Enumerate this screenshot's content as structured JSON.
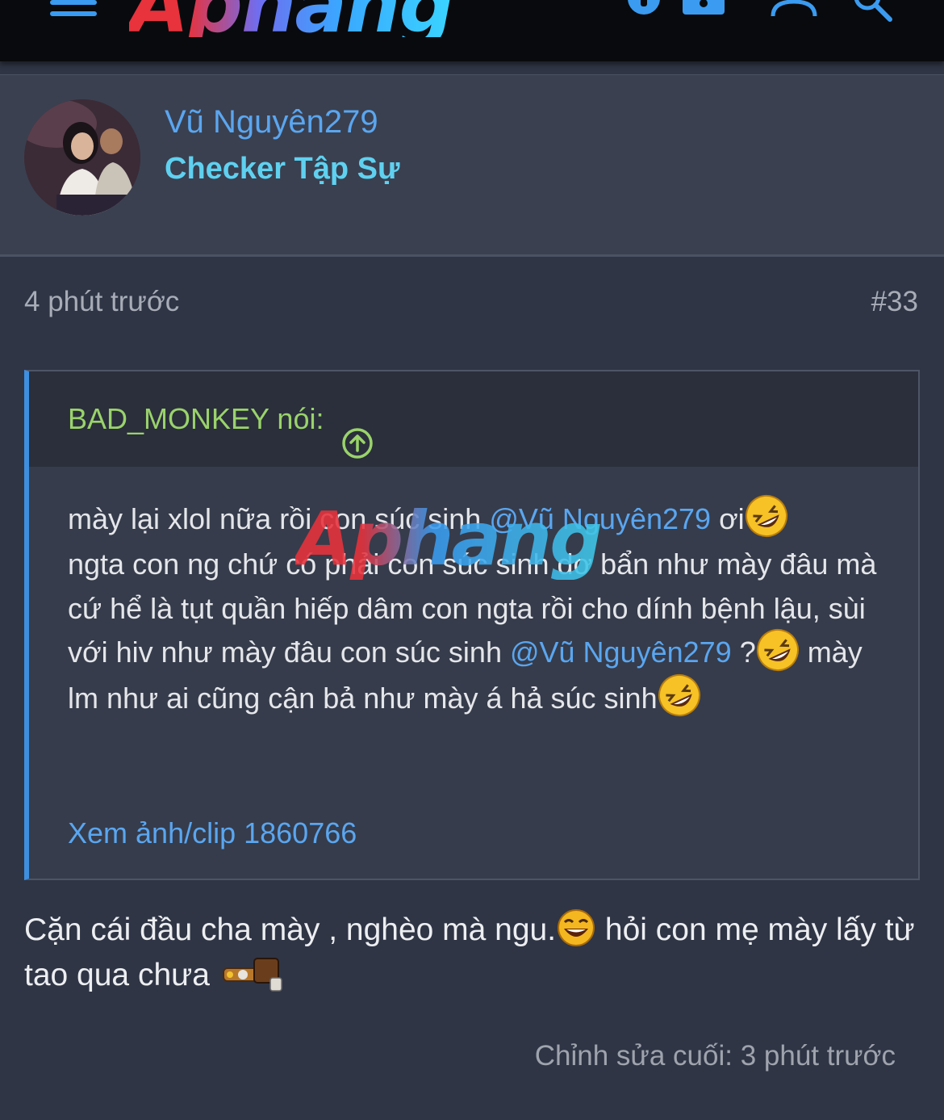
{
  "header": {
    "logo_text": "Aphang",
    "icons": [
      "menu-icon",
      "info-icon",
      "lock-icon",
      "user-icon",
      "search-icon"
    ],
    "accent": "#3a9bf0"
  },
  "post": {
    "author": {
      "name": "Vũ Nguyên279",
      "title": "Checker Tập Sự"
    },
    "time": "4 phút trước",
    "number": "#33",
    "quote": {
      "header": "BAD_MONKEY nói:",
      "segments": {
        "s1": "mày lại xlol nữa rồi con súc sinh ",
        "m1": "@Vũ Nguyên279",
        "s2": " ơi",
        "s3": "ngta con ng chứ có phải con súc sinh dơ bẩn như mày đâu mà cứ hể là tụt quần hiếp dâm con ngta rồi cho dính bệnh lậu, sùi với hiv như mày đâu con súc sinh ",
        "m2": "@Vũ Nguyên279",
        "s4": " ?",
        "s5": " mày lm như ai cũng cận bả như mày á hả súc sinh"
      },
      "link": "Xem ảnh/clip 1860766",
      "watermark": "Aphang"
    },
    "reply": {
      "part1": "Cặn cái đầu cha mày , nghèo mà ngu.",
      "part2": " hỏi con mẹ mày lấy từ tao qua chưa "
    },
    "edited": "Chỉnh sửa cuối: 3 phút trước"
  },
  "colors": {
    "background": "#2f3545",
    "link": "#5aa6f0",
    "quote_author": "#9ad36b",
    "user_title": "#5fd1f0"
  }
}
